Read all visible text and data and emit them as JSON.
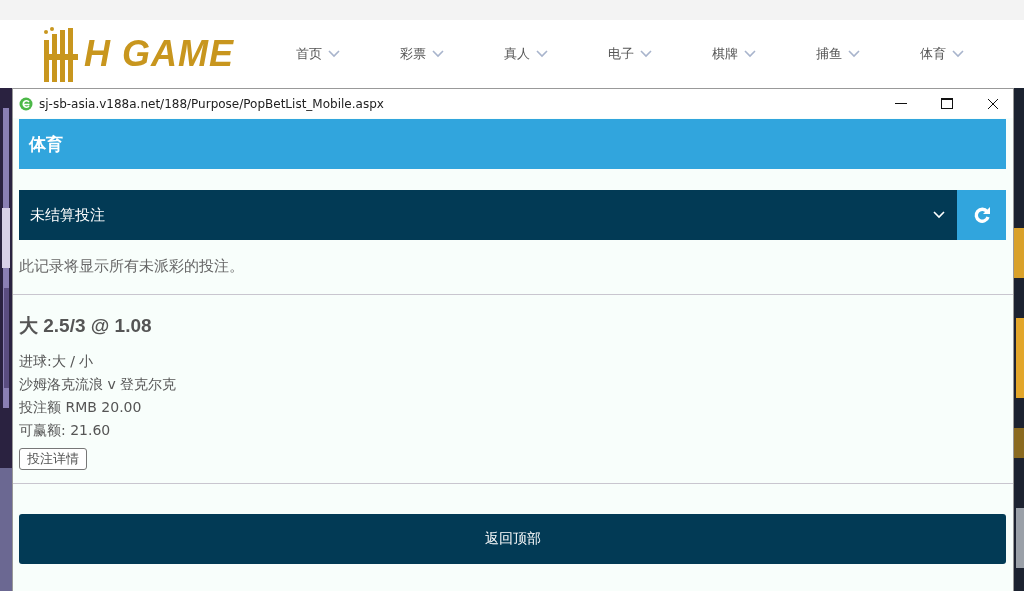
{
  "site": {
    "logo": "H GAME",
    "nav": [
      {
        "label": "首页"
      },
      {
        "label": "彩票"
      },
      {
        "label": "真人"
      },
      {
        "label": "电子"
      },
      {
        "label": "棋牌"
      },
      {
        "label": "捕鱼"
      },
      {
        "label": "体育"
      }
    ]
  },
  "popup": {
    "url": "sj-sb-asia.v188a.net/188/Purpose/PopBetList_Mobile.aspx",
    "header": "体育",
    "filter": {
      "value": "未结算投注"
    },
    "note": "此记录将显示所有未派彩的投注。",
    "bets": [
      {
        "title": "大 2.5/3 @ 1.08",
        "lines": [
          "进球:大 / 小",
          "沙姆洛克流浪 v 登克尔克",
          "投注额 RMB 20.00",
          "可赢额: 21.60"
        ],
        "details_button": "投注详情"
      }
    ],
    "back_to_top": "返回顶部"
  }
}
